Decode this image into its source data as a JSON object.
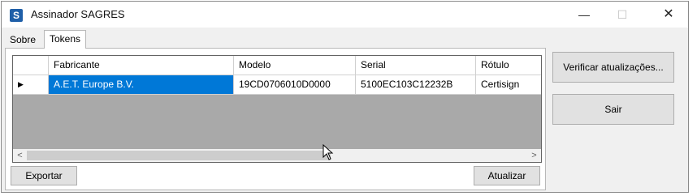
{
  "window": {
    "title": "Assinador SAGRES",
    "icon_letter": "S",
    "controls": {
      "minimize": "—",
      "maximize": "☐",
      "close": "✕"
    }
  },
  "tabs": [
    {
      "label": "Sobre",
      "active": false
    },
    {
      "label": "Tokens",
      "active": true
    }
  ],
  "grid": {
    "columns": [
      "Fabricante",
      "Modelo",
      "Serial",
      "Rótulo"
    ],
    "rows": [
      {
        "marker": "▶",
        "fabricante": "A.E.T. Europe B.V.",
        "modelo": "19CD0706010D0000",
        "serial": "5100EC103C12232B",
        "rotulo": "Certisign"
      }
    ]
  },
  "scrollbar": {
    "left_arrow": "<",
    "right_arrow": ">"
  },
  "buttons": {
    "exportar": "Exportar",
    "atualizar": "Atualizar",
    "verificar": "Verificar atualizações...",
    "sair": "Sair"
  },
  "colors": {
    "selection": "#0078d7",
    "grid_background": "#a9a9a9"
  }
}
